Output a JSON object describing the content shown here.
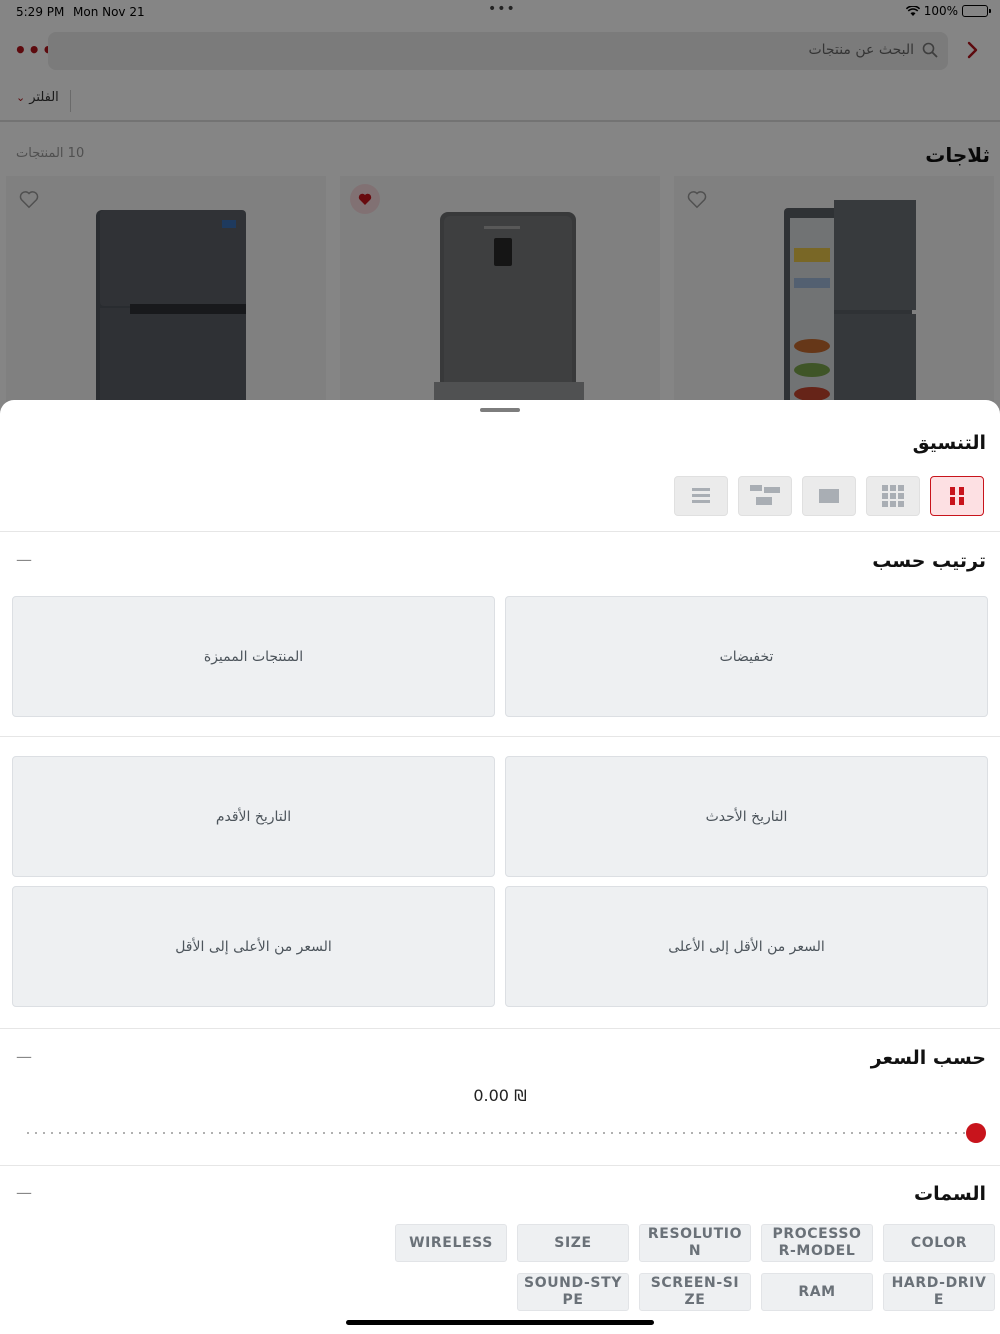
{
  "status_bar": {
    "time": "5:29 PM",
    "date": "Mon Nov 21",
    "dots": "•••",
    "battery": "100%"
  },
  "header": {
    "more_label": "•••",
    "search_placeholder": "البحث عن منتجات"
  },
  "filter": {
    "label": "الفلتر"
  },
  "category": {
    "title": "ثلاجات",
    "count": "10 المنتجات"
  },
  "products": [
    {
      "favorite": false
    },
    {
      "favorite": true
    },
    {
      "favorite": false
    }
  ],
  "sheet": {
    "layout_title": "التنسيق",
    "layout_options": [
      "grid-2",
      "grid-3",
      "single",
      "list-thumb",
      "list"
    ],
    "layout_selected": "grid-2",
    "sort_title": "ترتيب حسب",
    "sort_options": {
      "discounts": "تخفيضات",
      "featured": "المنتجات المميزة",
      "newest": "التاريخ الأحدث",
      "oldest": "التاريخ الأقدم",
      "price_low_high": "السعر من الأقل إلى الأعلى",
      "price_high_low": "السعر من الأعلى إلى الأقل"
    },
    "price_title": "حسب السعر",
    "price_value": "0.00 ₪",
    "attributes_title": "السمات",
    "attributes_row1": [
      "COLOR",
      "PROCESSOR-MODEL",
      "RESOLUTION",
      "SIZE",
      "WIRELESS"
    ],
    "attributes_row2": [
      "HARD-DRIVE",
      "RAM",
      "SCREEN-SIZE",
      "SOUND-STYPE"
    ],
    "collapse_symbol": "—"
  },
  "colors": {
    "accent": "#c8141c",
    "button_bg": "#eef0f2"
  }
}
